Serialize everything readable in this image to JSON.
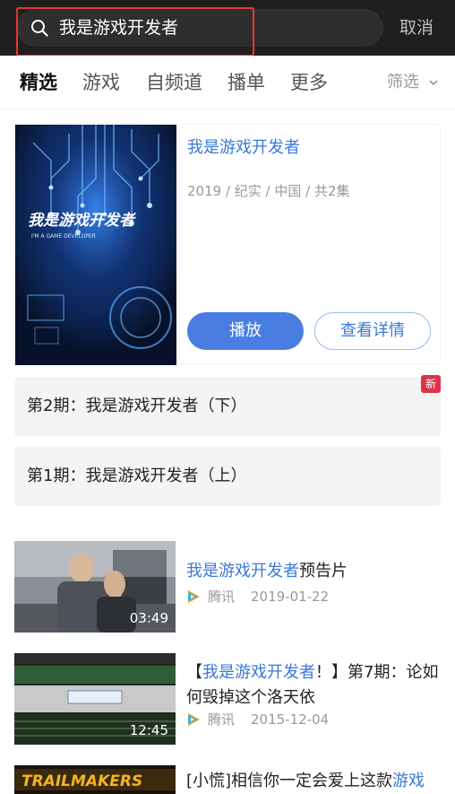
{
  "search": {
    "query": "我是游戏开发者",
    "cancel_label": "取消"
  },
  "tabs": [
    {
      "label": "精选"
    },
    {
      "label": "游戏"
    },
    {
      "label": "自频道"
    },
    {
      "label": "播单"
    },
    {
      "label": "更多"
    }
  ],
  "filter_label": "筛选",
  "feature": {
    "title": "我是游戏开发者",
    "meta": "2019 / 纪实 / 中国 / 共2集",
    "poster_title": "我是游戏开发者",
    "poster_subtitle": "I'M A GAME DEVELOPER",
    "play_label": "播放",
    "detail_label": "查看详情"
  },
  "episodes": [
    {
      "label": "第2期：我是游戏开发者（下）",
      "badge": "新"
    },
    {
      "label": "第1期：我是游戏开发者（上）"
    }
  ],
  "videos": [
    {
      "title_hl": "我是游戏开发者",
      "title_rest": "预告片",
      "source": "腾讯",
      "date": "2019-01-22",
      "duration": "03:49"
    },
    {
      "title_pre": "【",
      "title_hl": "我是游戏开发者",
      "title_rest": "！】第7期：论如何毁掉这个洛天依",
      "source": "腾讯",
      "date": "2015-12-04",
      "duration": "12:45"
    },
    {
      "title_pre": "[小慌]相信你一定会爱上这款",
      "title_hl": "游戏",
      "thumb_text": "TRAILMAKERS"
    }
  ],
  "colors": {
    "accent": "#3a78d8",
    "highlight_box": "#e2382f",
    "badge": "#e0334a",
    "topbar": "#1f1f1f"
  }
}
